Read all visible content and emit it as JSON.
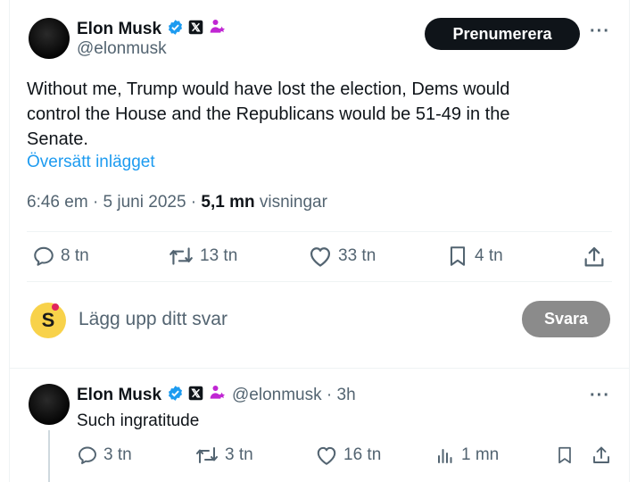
{
  "post": {
    "author_name": "Elon Musk",
    "author_handle": "@elonmusk",
    "subscribe_label": "Prenumerera",
    "more_label": "···",
    "text_line1": "Without me, Trump would have lost the election, Dems would",
    "text_line2": "control the House and the Republicans would be 51-49 in the",
    "text_line3": "Senate.",
    "translate_label": "Översätt inlägget",
    "time": "6:46 em",
    "date": "5 juni 2025",
    "views_count": "5,1 mn",
    "views_label": "visningar",
    "replies": "8 tn",
    "reposts": "13 tn",
    "likes": "33 tn",
    "bookmarks": "4 tn"
  },
  "composer": {
    "avatar_letter": "S",
    "placeholder": "Lägg upp ditt svar",
    "button_label": "Svara"
  },
  "reply": {
    "author_name": "Elon Musk",
    "author_handle": "@elonmusk",
    "time_ago": "3h",
    "more_label": "···",
    "text": "Such ingratitude",
    "replies": "3 tn",
    "reposts": "3 tn",
    "likes": "16 tn",
    "views": "1 mn"
  },
  "colors": {
    "verified_blue": "#1d9bf0",
    "affiliate_purple": "#c026d3",
    "link_blue": "#1d9bf0"
  },
  "icons": [
    "verified-badge-icon",
    "x-affiliate-icon",
    "people-icon",
    "reply-icon",
    "repost-icon",
    "like-icon",
    "bookmark-icon",
    "share-icon",
    "views-icon"
  ]
}
